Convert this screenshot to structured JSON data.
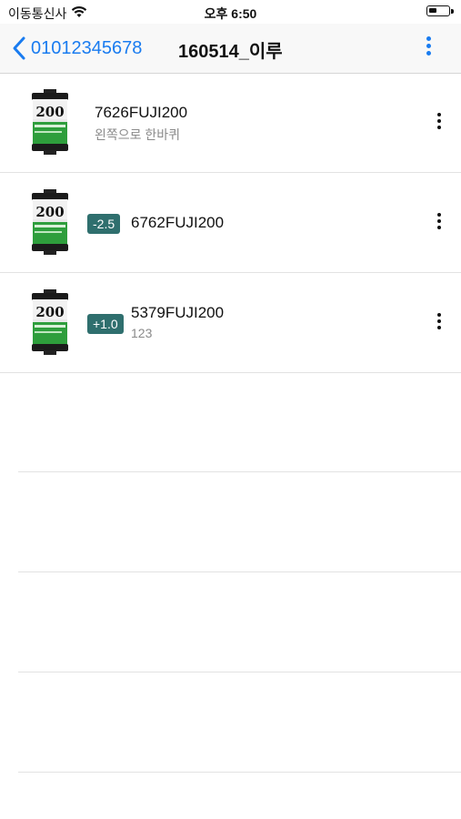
{
  "status_bar": {
    "carrier": "이동통신사",
    "time": "오후 6:50"
  },
  "nav": {
    "back_label": "01012345678",
    "title": "160514_이루"
  },
  "items": [
    {
      "name": "7626FUJI200",
      "note": "왼쪽으로 한바퀴",
      "exposure": "",
      "film_label": "200"
    },
    {
      "name": "6762FUJI200",
      "note": "",
      "exposure": "-2.5",
      "film_label": "200"
    },
    {
      "name": "5379FUJI200",
      "note": "123",
      "exposure": "+1.0",
      "film_label": "200"
    }
  ],
  "colors": {
    "accent": "#1a7cf0",
    "badge": "#2f6f6e",
    "film_green": "#2e9e3c"
  },
  "icons": [
    "wifi-icon",
    "battery-icon",
    "back-chevron-icon",
    "more-vertical-icon",
    "film-canister-icon"
  ]
}
